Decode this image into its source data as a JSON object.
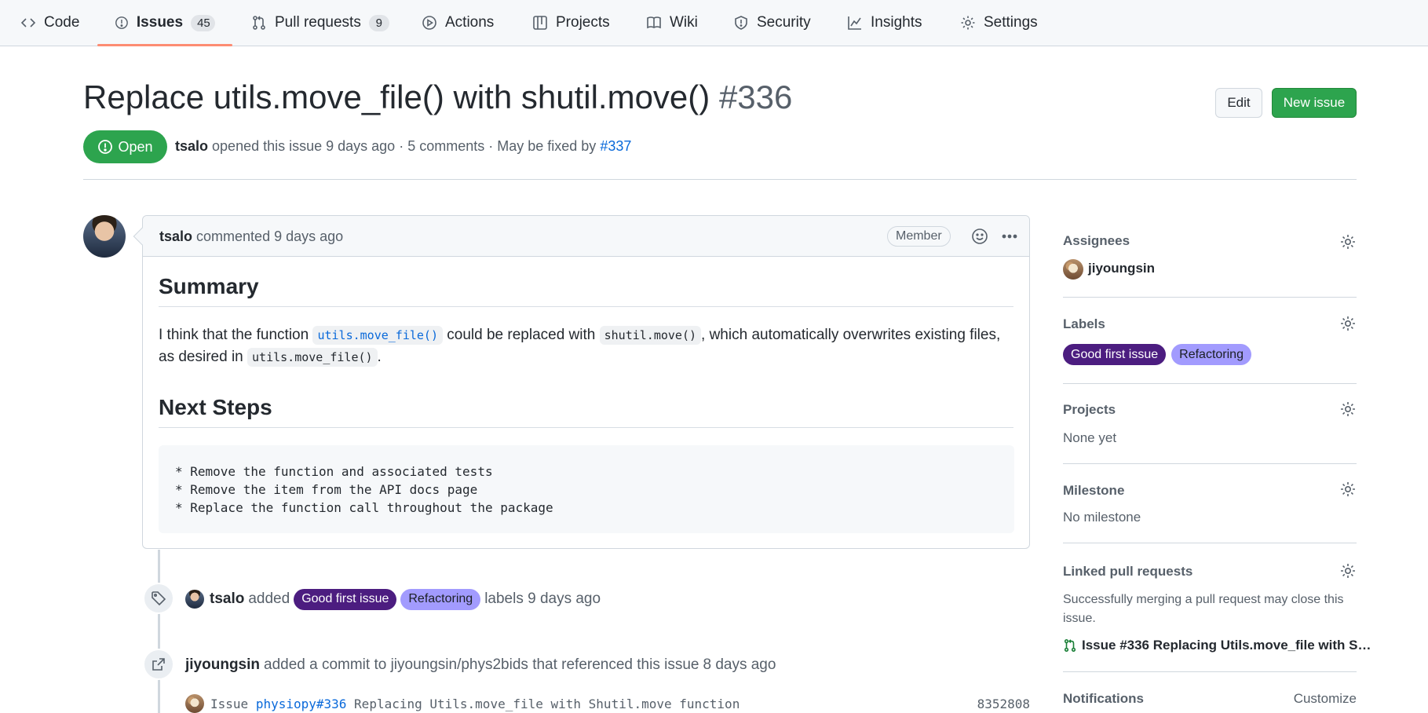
{
  "nav": {
    "tabs": [
      {
        "label": "Code",
        "icon": "code-icon"
      },
      {
        "label": "Issues",
        "icon": "issue-opened-icon",
        "count": "45"
      },
      {
        "label": "Pull requests",
        "icon": "git-pull-request-icon",
        "count": "9"
      },
      {
        "label": "Actions",
        "icon": "play-icon"
      },
      {
        "label": "Projects",
        "icon": "table-icon"
      },
      {
        "label": "Wiki",
        "icon": "book-icon"
      },
      {
        "label": "Security",
        "icon": "shield-icon"
      },
      {
        "label": "Insights",
        "icon": "graph-icon"
      },
      {
        "label": "Settings",
        "icon": "gear-icon"
      }
    ],
    "active_tab": "Issues"
  },
  "issue": {
    "title": "Replace utils.move_file() with shutil.move()",
    "number": "#336",
    "state": "Open",
    "author": "tsalo",
    "opened_text": "opened this issue 9 days ago · 5 comments · May be fixed by",
    "fix_pr": "#337"
  },
  "header_buttons": {
    "edit": "Edit",
    "new_issue": "New issue"
  },
  "comment": {
    "author": "tsalo",
    "time_text": "commented 9 days ago",
    "role_badge": "Member",
    "summary_heading": "Summary",
    "body_pre": "I think that the function ",
    "code_1": "utils.move_file()",
    "body_mid": " could be replaced with ",
    "code_2": "shutil.move()",
    "body_post": ", which automatically overwrites existing files, as desired in ",
    "code_3": "utils.move_file()",
    "body_end": ".",
    "next_heading": "Next Steps",
    "code_block": "* Remove the function and associated tests\n* Remove the item from the API docs page\n* Replace the function call throughout the package"
  },
  "timeline": {
    "label_event": {
      "actor": "tsalo",
      "verb": "added",
      "labels": [
        "Good first issue",
        "Refactoring"
      ],
      "suffix": "labels 9 days ago"
    },
    "ref_event": {
      "actor": "jiyoungsin",
      "text": "added a commit to jiyoungsin/phys2bids that referenced this issue",
      "time": "8 days ago"
    },
    "commit": {
      "prefix": "Issue",
      "ref": "physiopy#336",
      "message": "Replacing Utils.move_file with Shutil.move function",
      "sha": "8352808"
    }
  },
  "sidebar": {
    "assignees": {
      "title": "Assignees",
      "user": "jiyoungsin"
    },
    "labels": {
      "title": "Labels",
      "items": [
        "Good first issue",
        "Refactoring"
      ]
    },
    "projects": {
      "title": "Projects",
      "value": "None yet"
    },
    "milestone": {
      "title": "Milestone",
      "value": "No milestone"
    },
    "linked_prs": {
      "title": "Linked pull requests",
      "description": "Successfully merging a pull request may close this issue.",
      "pr_title": "Issue #336 Replacing Utils.move_file with S…"
    },
    "notifications": {
      "title": "Notifications",
      "action": "Customize"
    }
  },
  "colors": {
    "open_green": "#2da44e",
    "label_good_first_issue": "#4c1d80",
    "label_refactoring": "#a29bfe",
    "active_tab_underline": "#fd8c73",
    "link_blue": "#0969da"
  }
}
